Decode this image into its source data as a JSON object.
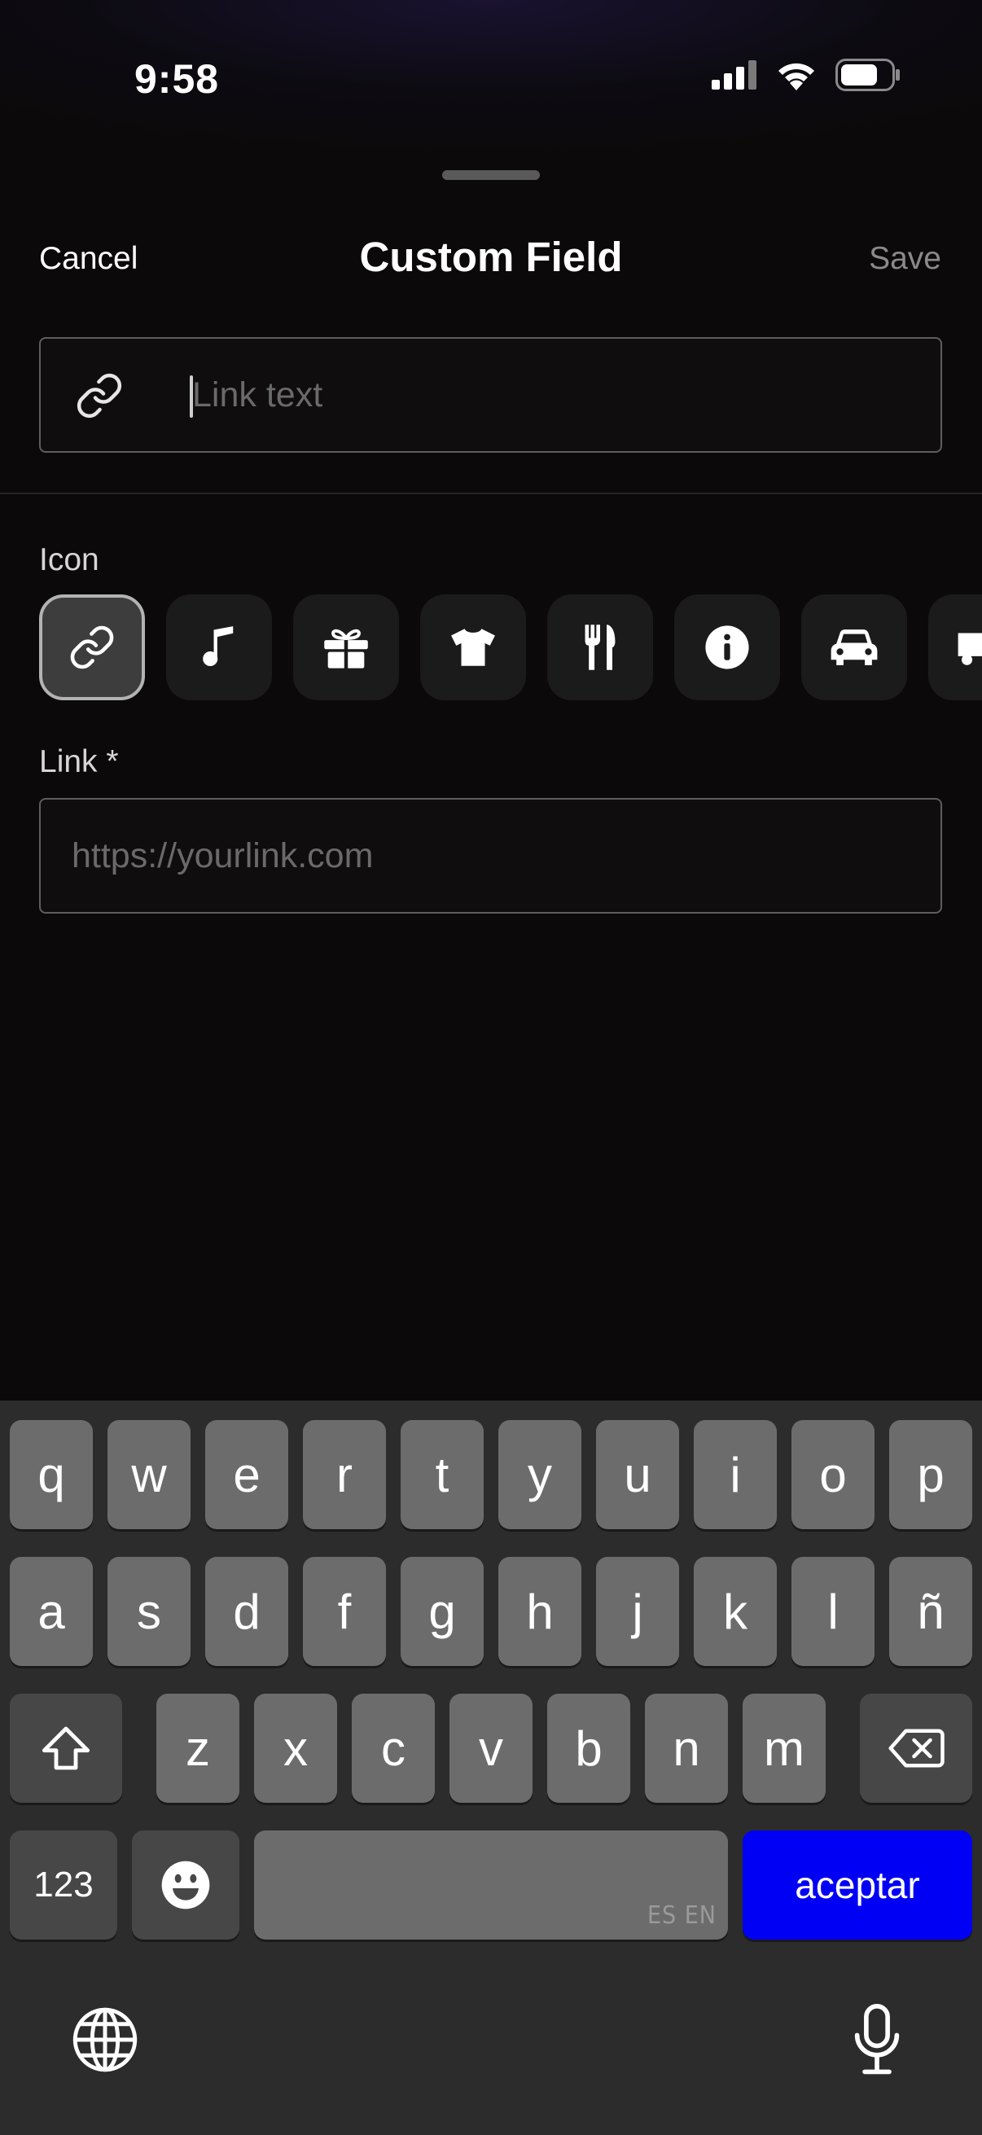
{
  "status_bar": {
    "time": "9:58"
  },
  "nav": {
    "cancel_label": "Cancel",
    "title": "Custom Field",
    "save_label": "Save"
  },
  "link_text_input": {
    "value": "",
    "placeholder": "Link text",
    "icon": "link-icon"
  },
  "icon_section": {
    "label": "Icon",
    "icons": [
      "link-icon",
      "music-note-icon",
      "gift-icon",
      "tshirt-icon",
      "utensils-icon",
      "info-icon",
      "car-icon",
      "truck-icon"
    ],
    "selected": "link-icon"
  },
  "link_input": {
    "label": "Link *",
    "value": "",
    "placeholder": "https://yourlink.com"
  },
  "keyboard": {
    "row1": [
      "q",
      "w",
      "e",
      "r",
      "t",
      "y",
      "u",
      "i",
      "o",
      "p"
    ],
    "row2": [
      "a",
      "s",
      "d",
      "f",
      "g",
      "h",
      "j",
      "k",
      "l",
      "ñ"
    ],
    "row3": [
      "z",
      "x",
      "c",
      "v",
      "b",
      "n",
      "m"
    ],
    "numbers_label": "123",
    "space_languages": "ES EN",
    "return_label": "aceptar",
    "icons": {
      "shift": "shift-icon",
      "backspace": "backspace-icon",
      "emoji": "emoji-icon",
      "globe": "globe-icon",
      "mic": "microphone-icon"
    },
    "return_color": "#0000f5"
  }
}
